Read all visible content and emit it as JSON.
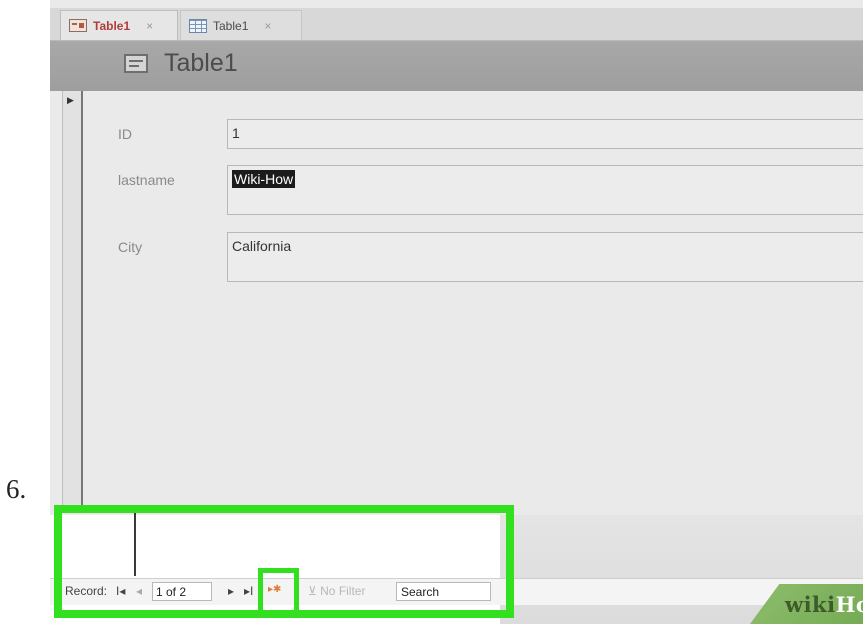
{
  "step_label": "6.",
  "tabs": [
    {
      "label": "Table1",
      "close": "×",
      "icon": "form-icon",
      "active": true
    },
    {
      "label": "Table1",
      "close": "×",
      "icon": "table-icon",
      "active": false
    }
  ],
  "form": {
    "title": "Table1",
    "fields": [
      {
        "label": "ID",
        "value": "1"
      },
      {
        "label": "lastname",
        "value": "Wiki-How"
      },
      {
        "label": "City",
        "value": "California"
      }
    ]
  },
  "navigation": {
    "record_label": "Record:",
    "first_icon": "I◂",
    "prev_icon": "◂",
    "current_record": "1 of 2",
    "next_icon": "▸",
    "last_icon": "▸I",
    "new_record_icon": "▸✱",
    "filter_label": "No Filter",
    "search_label": "Search"
  },
  "highlight_color": "#33e020",
  "watermark": {
    "brand_prefix": "wiki",
    "brand_suffix": "How"
  }
}
